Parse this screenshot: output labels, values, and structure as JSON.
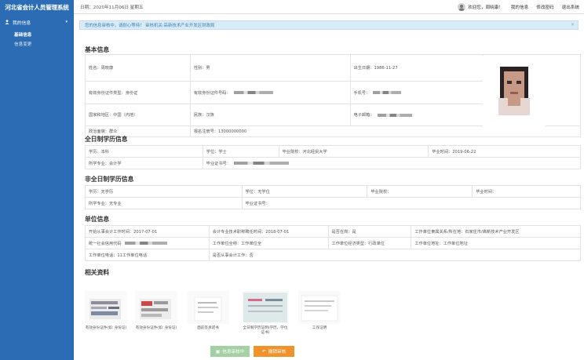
{
  "header": {
    "brand": "河北省会计人员管理系统",
    "date": "日期：2020年11月06日 星期五",
    "welcome": "欢迎您，周晓康！",
    "links": [
      "我的信息",
      "修改密码",
      "退出系统"
    ]
  },
  "sidebar": {
    "group": "我的信息",
    "items": [
      "基础信息",
      "信息变更"
    ]
  },
  "alert": {
    "text": "您的信息审核中，请耐心等待！  审核机关:高新技术产业开发区财政局",
    "close": "×"
  },
  "sections": {
    "basic": "基本信息",
    "fulltime": "全日制学历信息",
    "parttime": "非全日制学历信息",
    "unit": "单位信息",
    "docs": "相关资料"
  },
  "basic": {
    "name": "姓名：周晓康",
    "gender": "性别：男",
    "birth": "出生日期：1986-11-27",
    "idtype": "有效身份证件类型：身份证",
    "idno": "有效身份证件号码：",
    "phone": "手机号：",
    "country": "国家和地区：中国（内地）",
    "nation": "民族：汉族",
    "email": "电子邮箱：",
    "politics": "政治面貌：群众",
    "regno": "报名注册号：13000000000"
  },
  "fulltime": {
    "edu": "学历：本科",
    "degree": "学位：学士",
    "school": "毕业院校：河北经贸大学",
    "gradtime": "毕业时间：2019-06-22",
    "major": "所学专业：会计学",
    "cert": "毕业证书号："
  },
  "parttime": {
    "edu": "学历：无学历",
    "degree": "学位：无学位",
    "school": "毕业院校：",
    "gradtime": "毕业时间：",
    "major": "所学专业：无专业",
    "cert": "毕业证书号："
  },
  "unit": {
    "workstart": "开始从事会计工作时间：2017-07-01",
    "titletime": "会计专业技术职称聘任时间：2018-07-01",
    "onjob": "是否在岗：是",
    "location": "工作单位隶属关系/所在地：石家庄市/高新技术产业开发区",
    "creditcode": "统一社会信用代码",
    "unitname": "工作单位全称：工作单位全",
    "econtype": "工作单位经济类型：行政单位",
    "address": "工作单位地址：工作单位地址",
    "tel": "工作单位电话：11工作单位电话",
    "isacct": "是否从事会计工作：否"
  },
  "documents": [
    {
      "caption": "有效身份证件(如: 身份证)"
    },
    {
      "caption": "有效身份证件(如: 身份证)"
    },
    {
      "caption": "面前签承诺书"
    },
    {
      "caption": "全日制学历证明(学历、学位证书)"
    },
    {
      "caption": "工作证明"
    }
  ],
  "buttons": {
    "pending": "信息审核中",
    "withdraw": "撤销审核"
  },
  "colors": {
    "primary": "#2b6cb4",
    "alert_bg": "#d9ebf7",
    "green_btn": "#a4d1a4",
    "orange_btn": "#f0932b"
  }
}
